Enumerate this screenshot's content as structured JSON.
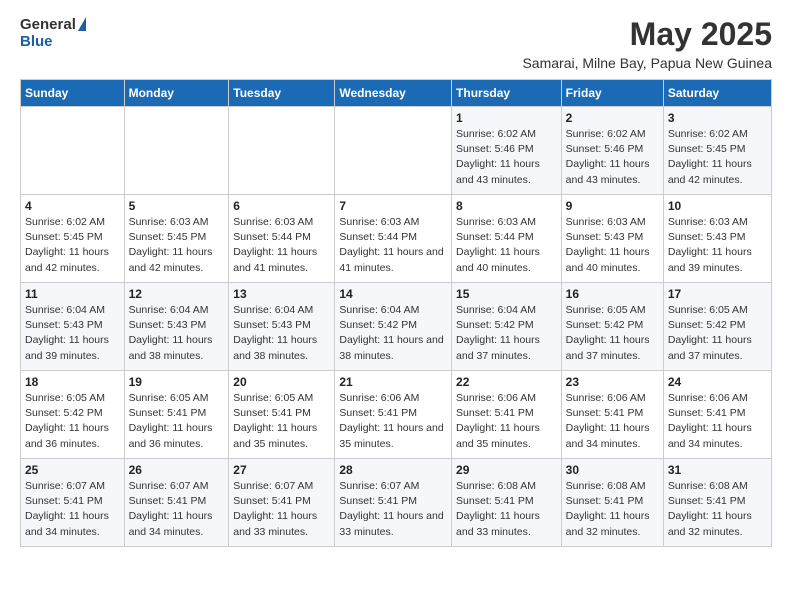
{
  "logo": {
    "general": "General",
    "blue": "Blue"
  },
  "title": "May 2025",
  "subtitle": "Samarai, Milne Bay, Papua New Guinea",
  "days_of_week": [
    "Sunday",
    "Monday",
    "Tuesday",
    "Wednesday",
    "Thursday",
    "Friday",
    "Saturday"
  ],
  "weeks": [
    [
      {
        "day": "",
        "info": ""
      },
      {
        "day": "",
        "info": ""
      },
      {
        "day": "",
        "info": ""
      },
      {
        "day": "",
        "info": ""
      },
      {
        "day": "1",
        "info": "Sunrise: 6:02 AM\nSunset: 5:46 PM\nDaylight: 11 hours and 43 minutes."
      },
      {
        "day": "2",
        "info": "Sunrise: 6:02 AM\nSunset: 5:46 PM\nDaylight: 11 hours and 43 minutes."
      },
      {
        "day": "3",
        "info": "Sunrise: 6:02 AM\nSunset: 5:45 PM\nDaylight: 11 hours and 42 minutes."
      }
    ],
    [
      {
        "day": "4",
        "info": "Sunrise: 6:02 AM\nSunset: 5:45 PM\nDaylight: 11 hours and 42 minutes."
      },
      {
        "day": "5",
        "info": "Sunrise: 6:03 AM\nSunset: 5:45 PM\nDaylight: 11 hours and 42 minutes."
      },
      {
        "day": "6",
        "info": "Sunrise: 6:03 AM\nSunset: 5:44 PM\nDaylight: 11 hours and 41 minutes."
      },
      {
        "day": "7",
        "info": "Sunrise: 6:03 AM\nSunset: 5:44 PM\nDaylight: 11 hours and 41 minutes."
      },
      {
        "day": "8",
        "info": "Sunrise: 6:03 AM\nSunset: 5:44 PM\nDaylight: 11 hours and 40 minutes."
      },
      {
        "day": "9",
        "info": "Sunrise: 6:03 AM\nSunset: 5:43 PM\nDaylight: 11 hours and 40 minutes."
      },
      {
        "day": "10",
        "info": "Sunrise: 6:03 AM\nSunset: 5:43 PM\nDaylight: 11 hours and 39 minutes."
      }
    ],
    [
      {
        "day": "11",
        "info": "Sunrise: 6:04 AM\nSunset: 5:43 PM\nDaylight: 11 hours and 39 minutes."
      },
      {
        "day": "12",
        "info": "Sunrise: 6:04 AM\nSunset: 5:43 PM\nDaylight: 11 hours and 38 minutes."
      },
      {
        "day": "13",
        "info": "Sunrise: 6:04 AM\nSunset: 5:43 PM\nDaylight: 11 hours and 38 minutes."
      },
      {
        "day": "14",
        "info": "Sunrise: 6:04 AM\nSunset: 5:42 PM\nDaylight: 11 hours and 38 minutes."
      },
      {
        "day": "15",
        "info": "Sunrise: 6:04 AM\nSunset: 5:42 PM\nDaylight: 11 hours and 37 minutes."
      },
      {
        "day": "16",
        "info": "Sunrise: 6:05 AM\nSunset: 5:42 PM\nDaylight: 11 hours and 37 minutes."
      },
      {
        "day": "17",
        "info": "Sunrise: 6:05 AM\nSunset: 5:42 PM\nDaylight: 11 hours and 37 minutes."
      }
    ],
    [
      {
        "day": "18",
        "info": "Sunrise: 6:05 AM\nSunset: 5:42 PM\nDaylight: 11 hours and 36 minutes."
      },
      {
        "day": "19",
        "info": "Sunrise: 6:05 AM\nSunset: 5:41 PM\nDaylight: 11 hours and 36 minutes."
      },
      {
        "day": "20",
        "info": "Sunrise: 6:05 AM\nSunset: 5:41 PM\nDaylight: 11 hours and 35 minutes."
      },
      {
        "day": "21",
        "info": "Sunrise: 6:06 AM\nSunset: 5:41 PM\nDaylight: 11 hours and 35 minutes."
      },
      {
        "day": "22",
        "info": "Sunrise: 6:06 AM\nSunset: 5:41 PM\nDaylight: 11 hours and 35 minutes."
      },
      {
        "day": "23",
        "info": "Sunrise: 6:06 AM\nSunset: 5:41 PM\nDaylight: 11 hours and 34 minutes."
      },
      {
        "day": "24",
        "info": "Sunrise: 6:06 AM\nSunset: 5:41 PM\nDaylight: 11 hours and 34 minutes."
      }
    ],
    [
      {
        "day": "25",
        "info": "Sunrise: 6:07 AM\nSunset: 5:41 PM\nDaylight: 11 hours and 34 minutes."
      },
      {
        "day": "26",
        "info": "Sunrise: 6:07 AM\nSunset: 5:41 PM\nDaylight: 11 hours and 34 minutes."
      },
      {
        "day": "27",
        "info": "Sunrise: 6:07 AM\nSunset: 5:41 PM\nDaylight: 11 hours and 33 minutes."
      },
      {
        "day": "28",
        "info": "Sunrise: 6:07 AM\nSunset: 5:41 PM\nDaylight: 11 hours and 33 minutes."
      },
      {
        "day": "29",
        "info": "Sunrise: 6:08 AM\nSunset: 5:41 PM\nDaylight: 11 hours and 33 minutes."
      },
      {
        "day": "30",
        "info": "Sunrise: 6:08 AM\nSunset: 5:41 PM\nDaylight: 11 hours and 32 minutes."
      },
      {
        "day": "31",
        "info": "Sunrise: 6:08 AM\nSunset: 5:41 PM\nDaylight: 11 hours and 32 minutes."
      }
    ]
  ]
}
